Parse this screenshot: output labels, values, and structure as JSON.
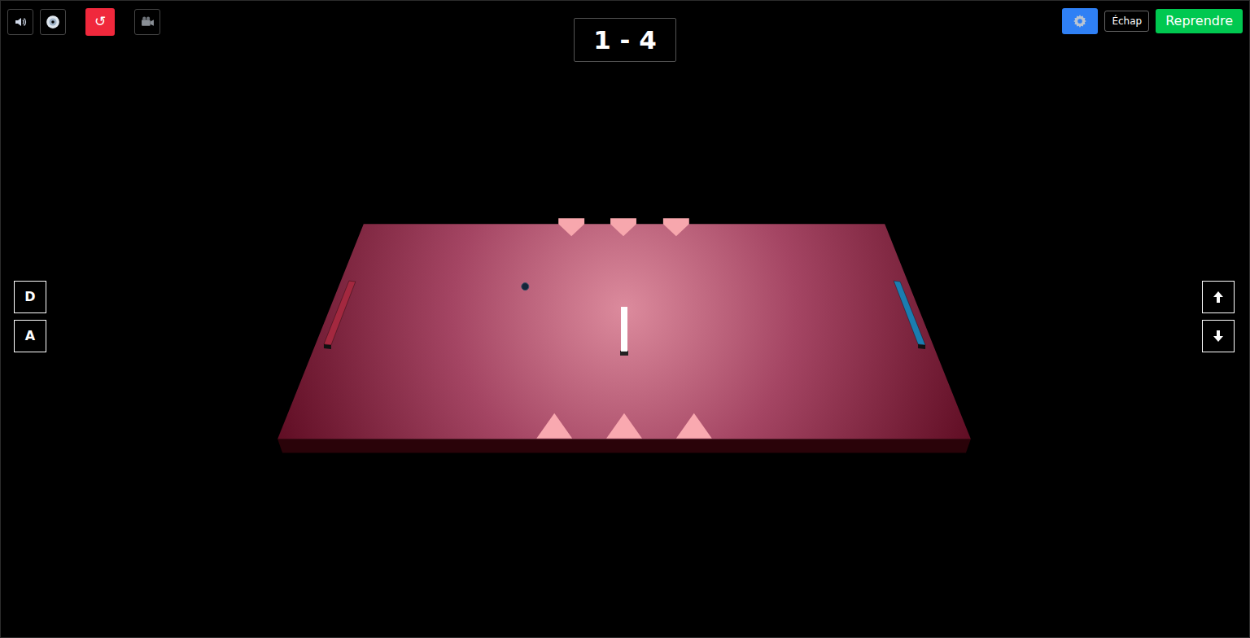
{
  "score": "1 - 4",
  "restart": "↺",
  "escape_hint": "Échap",
  "resume": "Reprendre",
  "left_keys": [
    "D",
    "A"
  ],
  "paddles": [
    {
      "color": "#a3283f"
    },
    {
      "color": "#1b7db0"
    }
  ]
}
